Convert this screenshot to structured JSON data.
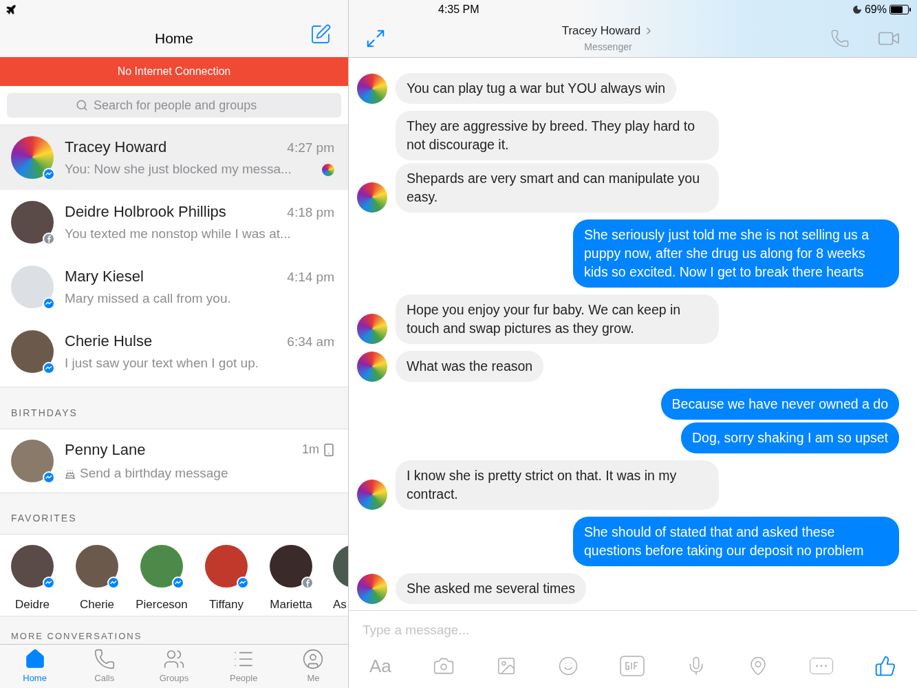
{
  "status_bar": {
    "time": "4:35 PM",
    "battery": "69%"
  },
  "sidebar": {
    "title": "Home",
    "banner": "No Internet Connection",
    "search": {
      "placeholder": "Search for people and groups"
    },
    "conversations": [
      {
        "name": "Tracey Howard",
        "time": "4:27 pm",
        "preview": "You: Now she just blocked my messa...",
        "kind": "messenger",
        "selected": true,
        "seen": true
      },
      {
        "name": "Deidre Holbrook Phillips",
        "time": "4:18 pm",
        "preview": "You texted me nonstop while I was at...",
        "kind": "facebook",
        "selected": false,
        "seen": false
      },
      {
        "name": "Mary Kiesel",
        "time": "4:14 pm",
        "preview": "Mary missed a call from you.",
        "kind": "messenger",
        "selected": false,
        "seen": false
      },
      {
        "name": "Cherie Hulse",
        "time": "6:34 am",
        "preview": "I just saw your text when I got up.",
        "kind": "messenger",
        "selected": false,
        "seen": false
      }
    ],
    "birthdays": {
      "heading": "BIRTHDAYS",
      "name": "Penny Lane",
      "time": "1m",
      "action": "Send a birthday message",
      "kind": "messenger"
    },
    "favorites": {
      "heading": "FAVORITES",
      "people": [
        {
          "name": "Deidre",
          "kind": "messenger"
        },
        {
          "name": "Cherie",
          "kind": "messenger"
        },
        {
          "name": "Pierceson",
          "kind": "messenger"
        },
        {
          "name": "Tiffany",
          "kind": "messenger"
        },
        {
          "name": "Marietta",
          "kind": "facebook"
        },
        {
          "name": "As",
          "kind": "none"
        }
      ]
    },
    "more_heading": "MORE CONVERSATIONS",
    "tabs": [
      {
        "label": "Home",
        "selected": true
      },
      {
        "label": "Calls",
        "selected": false
      },
      {
        "label": "Groups",
        "selected": false
      },
      {
        "label": "People",
        "selected": false
      },
      {
        "label": "Me",
        "selected": false
      }
    ]
  },
  "chat": {
    "title": "Tracey Howard",
    "subtitle": "Messenger",
    "messages": [
      {
        "kind": "incoming",
        "text": "You can play tug a war but YOU always win",
        "avatar": true
      },
      {
        "kind": "incoming",
        "text": "They are aggressive by breed. They play hard to not discourage it.",
        "avatar": false
      },
      {
        "kind": "incoming",
        "text": "Shepards are very smart and can manipulate you easy.",
        "avatar": true
      },
      {
        "kind": "outgoing",
        "text": "She seriously just told me she is not selling us a puppy now, after she drug us along for 8 weeks kids so excited. Now I get to break there hearts"
      },
      {
        "kind": "incoming",
        "text": "Hope you enjoy your fur baby. We can keep in touch and swap pictures as they grow.",
        "avatar": true
      },
      {
        "kind": "incoming",
        "text": "What was the reason",
        "avatar": true
      },
      {
        "kind": "outgoing",
        "text": "Because we have never owned a do"
      },
      {
        "kind": "outgoing",
        "text": "Dog, sorry shaking I am so upset"
      },
      {
        "kind": "incoming",
        "text": "I know she is pretty strict on that. It was in my contract.",
        "avatar": true
      },
      {
        "kind": "outgoing",
        "text": "She should of stated that and asked these questions before taking our deposit no problem"
      },
      {
        "kind": "incoming",
        "text": "She asked me several times",
        "avatar": true
      }
    ],
    "composer": {
      "placeholder": "Type a message...",
      "font_button": "Aa"
    }
  }
}
